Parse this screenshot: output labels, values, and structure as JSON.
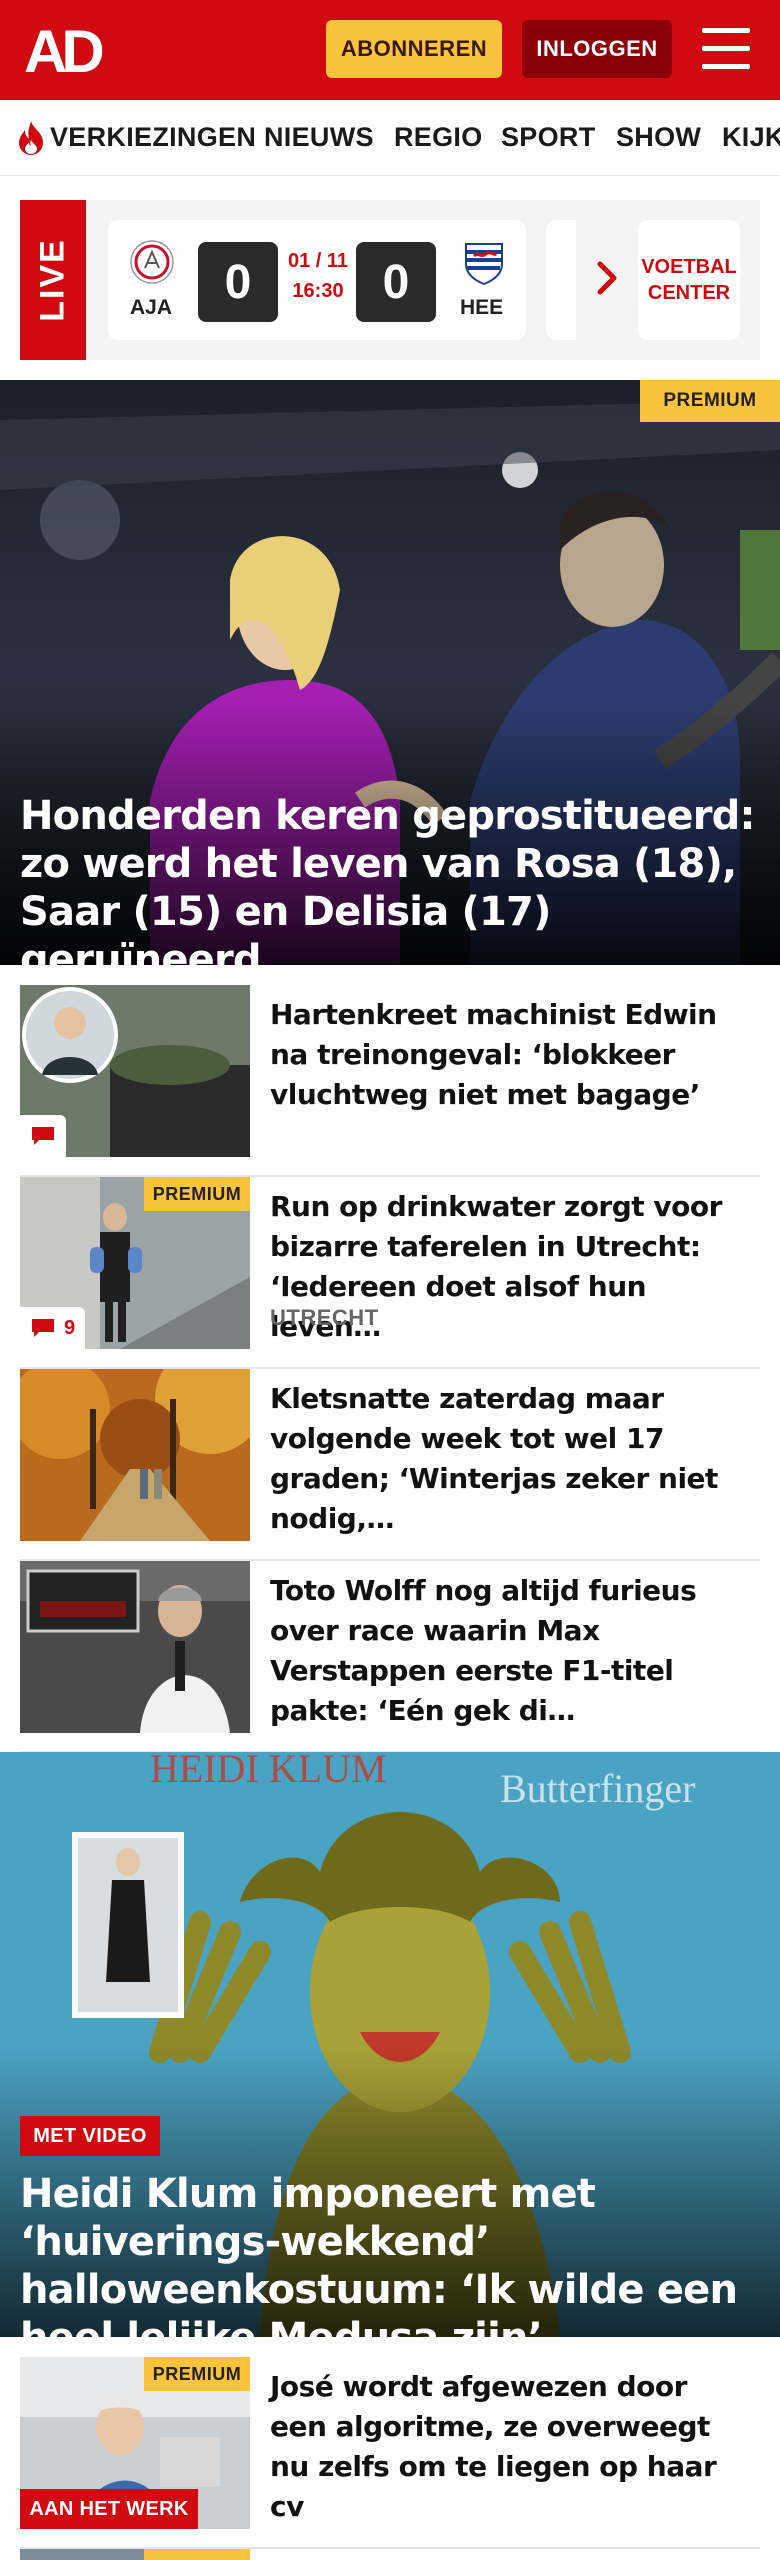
{
  "header": {
    "logo_text": "AD",
    "subscribe_label": "ABONNEREN",
    "login_label": "INLOGGEN",
    "colors": {
      "brand_red": "#d10a11",
      "accent_yellow": "#f9c33c",
      "login_dark": "#8c0008"
    }
  },
  "nav": {
    "items": [
      "VERKIEZINGEN",
      "NIEUWS",
      "REGIO",
      "SPORT",
      "SHOW",
      "KIJKEN"
    ]
  },
  "live": {
    "label": "LIVE",
    "match": {
      "home": "AJA",
      "away": "HEE",
      "home_score": "0",
      "away_score": "0",
      "date": "01 / 11",
      "time": "16:30"
    },
    "voetbal_center_label": "VOETBAL\nCENTER"
  },
  "hero": {
    "badge": "PREMIUM",
    "title": "Honderden keren geprostitueerd: zo werd het leven van Rosa (18), Saar (15) en Delisia (17) geruïneerd"
  },
  "articles": [
    {
      "title": "Hartenkreet machinist Edwin na treinongeval: ‘blokkeer vluchtweg niet met bagage’",
      "comments": "",
      "badge": "",
      "section": ""
    },
    {
      "title": "Run op drinkwater zorgt voor bizarre taferelen in Utrecht: ‘Iedereen doet alsof hun leven…",
      "comments": "9",
      "badge": "PREMIUM",
      "section": "UTRECHT"
    },
    {
      "title": "Kletsnatte zaterdag maar volgende week tot wel 17 graden; ‘Winterjas zeker niet nodig,…",
      "comments": "",
      "badge": "",
      "section": ""
    },
    {
      "title": "Toto Wolff nog altijd furieus over race waarin Max Verstappen eerste F1-titel pakte: ‘Eén gek di…",
      "comments": "",
      "badge": "",
      "section": ""
    }
  ],
  "feature": {
    "tag": "MET VIDEO",
    "title": "Heidi Klum imponeert met ‘huiverings-wekkend’ halloweenkostuum: ‘Ik wilde een heel lelijke Medusa zijn’"
  },
  "bottom_article": {
    "badge": "PREMIUM",
    "tag": "AAN HET WERK",
    "title": "José wordt afgewezen door een algoritme, ze overweegt nu zelfs om te liegen op haar cv"
  },
  "next_article": {
    "badge": "PREMIUM"
  }
}
